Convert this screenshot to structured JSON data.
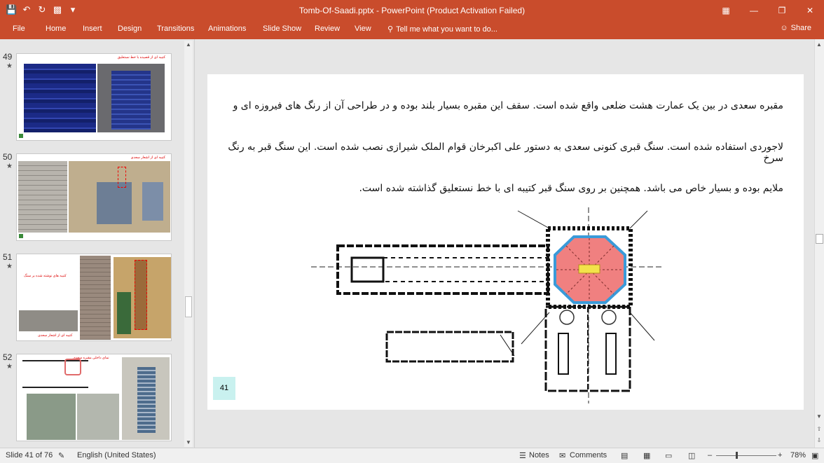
{
  "window": {
    "title": "Tomb-Of-Saadi.pptx - PowerPoint (Product Activation Failed)"
  },
  "ribbon": {
    "tabs": [
      "File",
      "Home",
      "Insert",
      "Design",
      "Transitions",
      "Animations",
      "Slide Show",
      "Review",
      "View"
    ],
    "tell_me": "Tell me what you want to do...",
    "share": "Share"
  },
  "thumbnails": [
    {
      "number": "49",
      "title": "کتیبه ای از قصیده با خط نستعلیق"
    },
    {
      "number": "50",
      "title": "کتیبه ای از اشعار سعدی"
    },
    {
      "number": "51",
      "title": "کتیبه های نوشته شده بر سنگ",
      "caption": "کتیبه ای از اشعار سعدی"
    },
    {
      "number": "52",
      "title": "نمای داخلی مقبره سعدی"
    }
  ],
  "slide": {
    "lines": [
      "مقبره سعدی در بین یک عمارت هشت ضلعی واقع شده است. سقف این مقبره بسیار بلند بوده و در طراحی آن از رنگ های فیروزه ای و",
      "لاجوردی استفاده شده است. سنگ قبری کنونی سعدی به دستور علی اکبرخان قوام الملک شیرازی نصب شده است. این سنگ قبر به رنگ سرخ",
      "ملایم بوده و بسیار خاص می باشد. همچنین بر روی سنگ قبر کتیبه ای با خط نستعلیق گذاشته شده است."
    ],
    "page_number": "41"
  },
  "status": {
    "slide_info": "Slide 41 of 76",
    "language": "English (United States)",
    "notes": "Notes",
    "comments": "Comments",
    "zoom": "78%"
  },
  "colors": {
    "accent": "#c94c2c",
    "octagon_fill": "#f08080",
    "octagon_stroke": "#3a9ad9",
    "tomb_fill": "#f2e34a"
  }
}
